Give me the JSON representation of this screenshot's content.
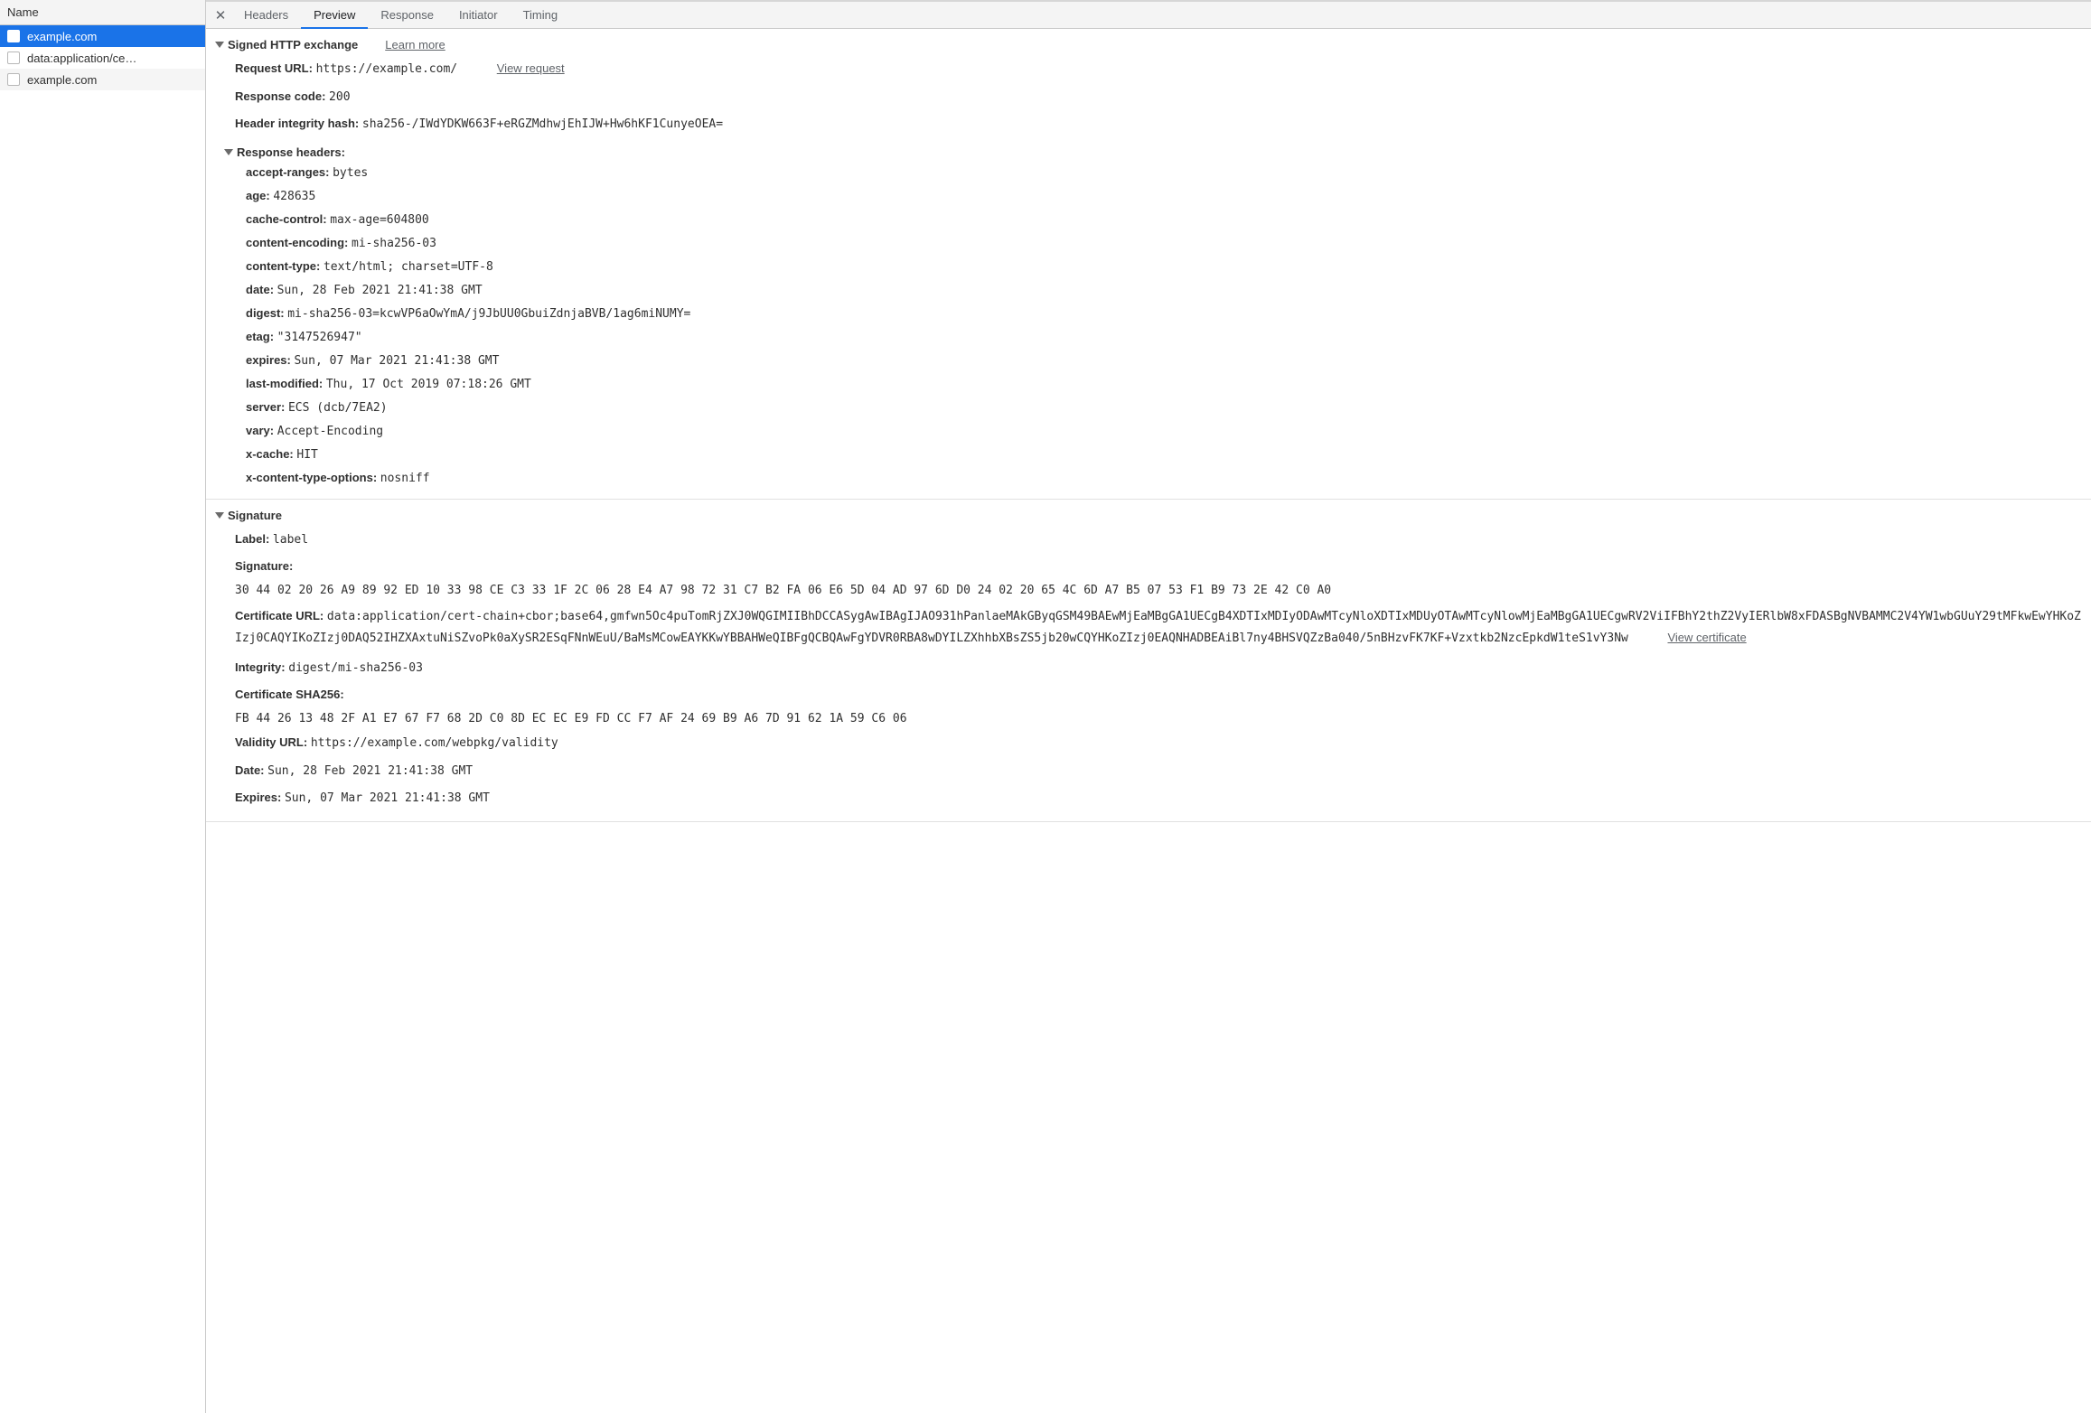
{
  "sidebar": {
    "header": "Name",
    "items": [
      {
        "label": "example.com",
        "selected": true
      },
      {
        "label": "data:application/ce…",
        "selected": false
      },
      {
        "label": "example.com",
        "selected": false
      }
    ]
  },
  "tabs": {
    "headers": "Headers",
    "preview": "Preview",
    "response": "Response",
    "initiator": "Initiator",
    "timing": "Timing"
  },
  "sxg": {
    "title": "Signed HTTP exchange",
    "learn_more": "Learn more",
    "request_url_label": "Request URL:",
    "request_url": "https://example.com/",
    "view_request": "View request",
    "response_code_label": "Response code:",
    "response_code": "200",
    "header_integrity_label": "Header integrity hash:",
    "header_integrity": "sha256-/IWdYDKW663F+eRGZMdhwjEhIJW+Hw6hKF1CunyeOEA=",
    "response_headers_title": "Response headers:",
    "response_headers": [
      {
        "k": "accept-ranges:",
        "v": "bytes"
      },
      {
        "k": "age:",
        "v": "428635"
      },
      {
        "k": "cache-control:",
        "v": "max-age=604800"
      },
      {
        "k": "content-encoding:",
        "v": "mi-sha256-03"
      },
      {
        "k": "content-type:",
        "v": "text/html; charset=UTF-8"
      },
      {
        "k": "date:",
        "v": "Sun, 28 Feb 2021 21:41:38 GMT"
      },
      {
        "k": "digest:",
        "v": "mi-sha256-03=kcwVP6aOwYmA/j9JbUU0GbuiZdnjaBVB/1ag6miNUMY="
      },
      {
        "k": "etag:",
        "v": "\"3147526947\""
      },
      {
        "k": "expires:",
        "v": "Sun, 07 Mar 2021 21:41:38 GMT"
      },
      {
        "k": "last-modified:",
        "v": "Thu, 17 Oct 2019 07:18:26 GMT"
      },
      {
        "k": "server:",
        "v": "ECS (dcb/7EA2)"
      },
      {
        "k": "vary:",
        "v": "Accept-Encoding"
      },
      {
        "k": "x-cache:",
        "v": "HIT"
      },
      {
        "k": "x-content-type-options:",
        "v": "nosniff"
      }
    ]
  },
  "sig": {
    "title": "Signature",
    "label_label": "Label:",
    "label_value": "label",
    "signature_label": "Signature:",
    "signature_value": "30 44 02 20 26 A9 89 92 ED 10 33 98 CE C3 33 1F 2C 06 28 E4 A7 98 72 31 C7 B2 FA 06 E6 5D 04 AD 97 6D D0 24 02 20 65 4C 6D A7 B5 07 53 F1 B9 73 2E 42 C0 A0",
    "cert_url_label": "Certificate URL:",
    "cert_url_value": "data:application/cert-chain+cbor;base64,gmfwn5Oc4puTomRjZXJ0WQGIMIIBhDCCASygAwIBAgIJAO931hPanlaeMAkGByqGSM49BAEwMjEaMBgGA1UECgB4XDTIxMDIyODAwMTcyNloXDTIxMDUyOTAwMTcyNlowMjEaMBgGA1UECgwRV2ViIFBhY2thZ2VyIERlbW8xFDASBgNVBAMMC2V4YW1wbGUuY29tMFkwEwYHKoZIzj0CAQYIKoZIzj0DAQ52IHZXAxtuNiSZvoPk0aXySR2ESqFNnWEuU/BaMsMCowEAYKKwYBBAHWeQIBFgQCBQAwFgYDVR0RBA8wDYILZXhhbXBsZS5jb20wCQYHKoZIzj0EAQNHADBEAiBl7ny4BHSVQZzBa040/5nBHzvFK7KF+Vzxtkb2NzcEpkdW1teS1vY3Nw",
    "view_cert": "View certificate",
    "integrity_label": "Integrity:",
    "integrity_value": "digest/mi-sha256-03",
    "cert_sha_label": "Certificate SHA256:",
    "cert_sha_value": "FB 44 26 13 48 2F A1 E7 67 F7 68 2D C0 8D EC EC E9 FD CC F7 AF 24 69 B9 A6 7D 91 62 1A 59 C6 06",
    "validity_url_label": "Validity URL:",
    "validity_url_value": "https://example.com/webpkg/validity",
    "date_label": "Date:",
    "date_value": "Sun, 28 Feb 2021 21:41:38 GMT",
    "expires_label": "Expires:",
    "expires_value": "Sun, 07 Mar 2021 21:41:38 GMT"
  }
}
